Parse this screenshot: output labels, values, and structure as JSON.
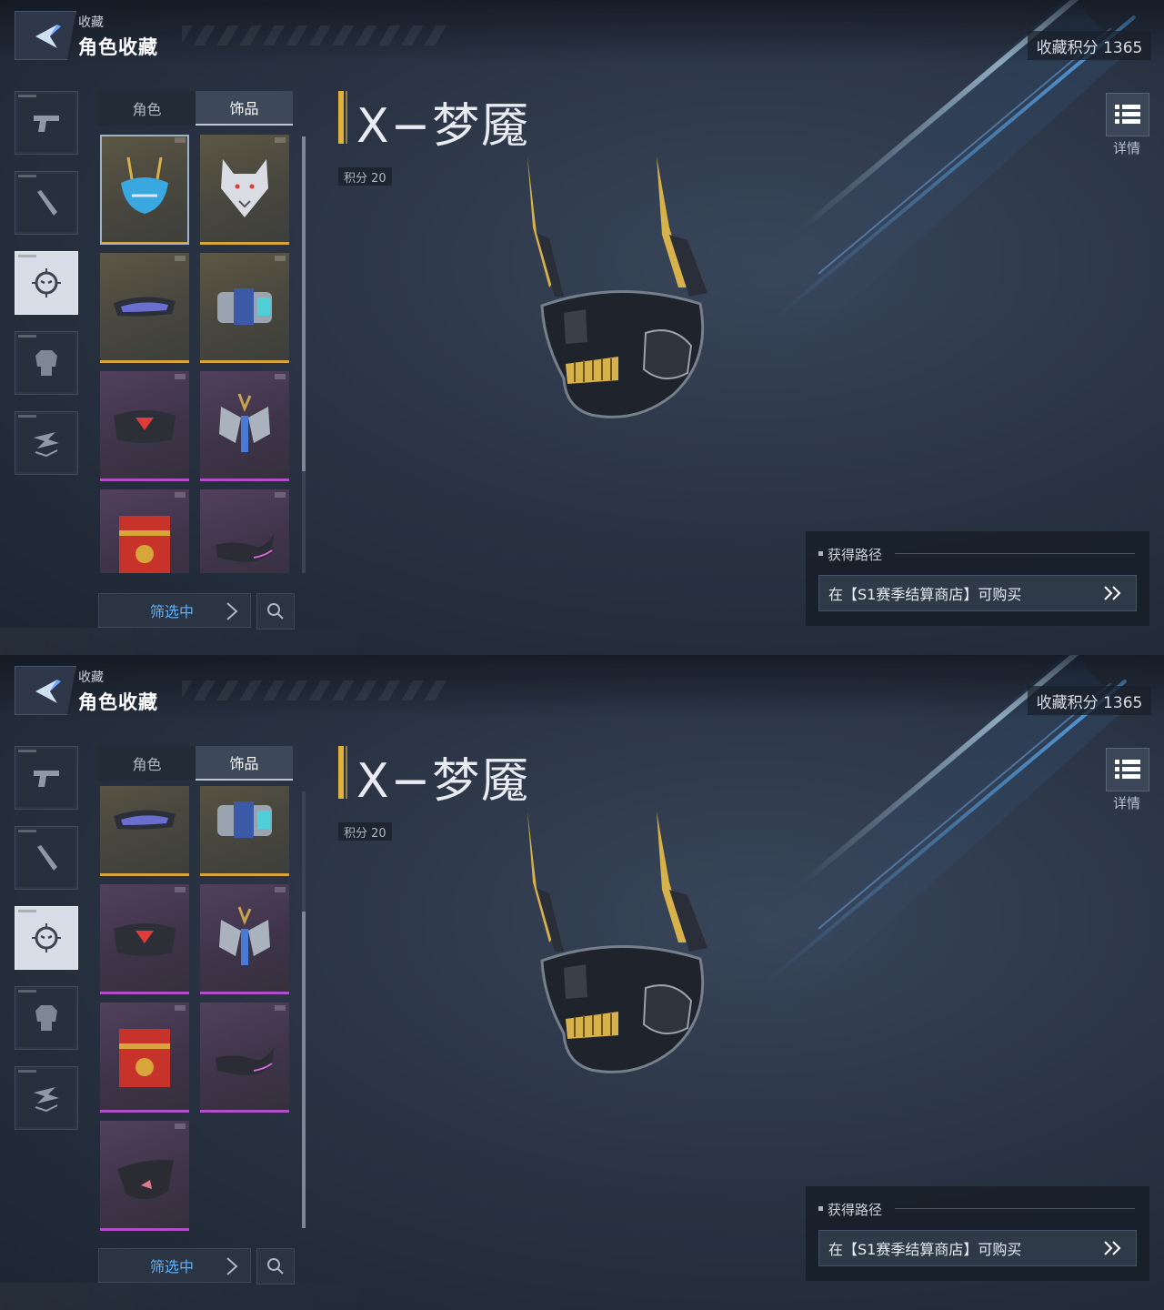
{
  "screens": [
    {
      "header": {
        "breadcrumb": "收藏",
        "title": "角色收藏",
        "score": "收藏积分 1365"
      },
      "side_nav": [
        {
          "icon": "pistol-icon",
          "active": false
        },
        {
          "icon": "melee-weapon-icon",
          "active": false
        },
        {
          "icon": "mask-face-icon",
          "active": true
        },
        {
          "icon": "armor-body-icon",
          "active": false
        },
        {
          "icon": "layers-icon",
          "active": false
        }
      ],
      "tabs": [
        {
          "label": "角色",
          "active": false
        },
        {
          "label": "饰品",
          "active": true
        }
      ],
      "grid": [
        {
          "item": "blue-oni-mask",
          "rarity": "gold",
          "selected": true
        },
        {
          "item": "wolf-head-mask",
          "rarity": "gold"
        },
        {
          "item": "visor-glasses",
          "rarity": "gold"
        },
        {
          "item": "mech-shoulder-gear",
          "rarity": "gold"
        },
        {
          "item": "red-visor-mask",
          "rarity": "purple"
        },
        {
          "item": "winged-ornament",
          "rarity": "purple"
        },
        {
          "item": "red-treasure-box",
          "rarity": "purple"
        },
        {
          "item": "dark-curved-mask",
          "rarity": "purple"
        }
      ],
      "filter_label": "筛选中",
      "item_title": "X−梦魇",
      "points": "积分 20",
      "details_label": "详情",
      "acquisition": {
        "label": "获得路径",
        "source": "在【S1赛季结算商店】可购买"
      }
    },
    {
      "header": {
        "breadcrumb": "收藏",
        "title": "角色收藏",
        "score": "收藏积分 1365"
      },
      "side_nav": [
        {
          "icon": "pistol-icon",
          "active": false
        },
        {
          "icon": "melee-weapon-icon",
          "active": false
        },
        {
          "icon": "mask-face-icon",
          "active": true
        },
        {
          "icon": "armor-body-icon",
          "active": false
        },
        {
          "icon": "layers-icon",
          "active": false
        }
      ],
      "tabs": [
        {
          "label": "角色",
          "active": false
        },
        {
          "label": "饰品",
          "active": true
        }
      ],
      "grid": [
        {
          "item": "visor-glasses",
          "rarity": "gold"
        },
        {
          "item": "mech-shoulder-gear",
          "rarity": "gold"
        },
        {
          "item": "red-visor-mask",
          "rarity": "purple"
        },
        {
          "item": "winged-ornament",
          "rarity": "purple"
        },
        {
          "item": "red-treasure-box",
          "rarity": "purple"
        },
        {
          "item": "dark-curved-mask",
          "rarity": "purple"
        },
        {
          "item": "black-face-mask",
          "rarity": "purple"
        }
      ],
      "filter_label": "筛选中",
      "item_title": "X−梦魇",
      "points": "积分 20",
      "details_label": "详情",
      "acquisition": {
        "label": "获得路径",
        "source": "在【S1赛季结算商店】可购买"
      }
    }
  ],
  "colors": {
    "gold_rarity": "#d8a53a",
    "purple_rarity": "#b04fc8",
    "filter_text": "#5fb0ff",
    "title_accent": "#e0b13c"
  }
}
